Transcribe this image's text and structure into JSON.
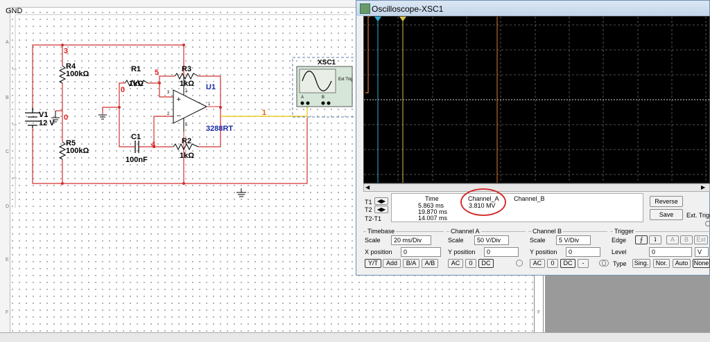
{
  "schematic": {
    "gnd_label": "GND",
    "row_letters": [
      "A",
      "B",
      "C",
      "D",
      "E",
      "F"
    ],
    "components": {
      "v1": {
        "name": "V1",
        "value": "12 V"
      },
      "r4": {
        "name": "R4",
        "value": "100kΩ"
      },
      "r5": {
        "name": "R5",
        "value": "100kΩ"
      },
      "r1": {
        "name": "R1",
        "value": "1kΩ"
      },
      "r3": {
        "name": "R3",
        "value": "1kΩ"
      },
      "r2": {
        "name": "R2",
        "value": "1kΩ"
      },
      "c1": {
        "name": "C1",
        "value": "100nF"
      },
      "u1": {
        "name": "U1",
        "part": "3288RT"
      },
      "xsc1": {
        "name": "XSC1",
        "ext_trig": "Ext Trig",
        "pin_a": "A",
        "pin_b": "B"
      }
    },
    "nodes": {
      "n3": "3",
      "n5": "5",
      "n0a": "0",
      "n0b": "0",
      "n4": "4",
      "n1": "1"
    },
    "opamp_pins": {
      "p1": "1",
      "p2": "2",
      "p3": "3",
      "p4": "4",
      "p5": "5"
    }
  },
  "oscilloscope": {
    "title": "Oscilloscope-XSC1",
    "readout": {
      "t1_label": "T1",
      "t2_label": "T2",
      "t2t1_label": "T2-T1",
      "time_header": "Time",
      "channel_a_header": "Channel_A",
      "channel_b_header": "Channel_B",
      "t1_time": "5.863 ms",
      "t2_time": "19.870 ms",
      "t2t1_time": "14.007 ms",
      "channel_a_value": "3.810 MV"
    },
    "buttons": {
      "reverse": "Reverse",
      "save": "Save",
      "ext_trigger": "Ext. Trigger"
    },
    "timebase": {
      "header": "Timebase",
      "scale_label": "Scale",
      "scale_value": "20 ms/Div",
      "xpos_label": "X position",
      "xpos_value": "0",
      "modes": [
        "Y/T",
        "Add",
        "B/A",
        "A/B"
      ]
    },
    "channel_a": {
      "header": "Channel A",
      "scale_label": "Scale",
      "scale_value": "50  V/Div",
      "ypos_label": "Y position",
      "ypos_value": "0",
      "coupling": [
        "AC",
        "0",
        "DC"
      ]
    },
    "channel_b": {
      "header": "Channel B",
      "scale_label": "Scale",
      "scale_value": "5  V/Div",
      "ypos_label": "Y position",
      "ypos_value": "0",
      "coupling": [
        "AC",
        "0",
        "DC",
        "-"
      ]
    },
    "trigger": {
      "header": "Trigger",
      "edge_label": "Edge",
      "level_label": "Level",
      "level_value": "0",
      "level_unit": "V",
      "type_label": "Type",
      "sources": [
        "A",
        "B",
        "Ext"
      ],
      "types": [
        "Sing.",
        "Nor.",
        "Auto",
        "None"
      ]
    }
  },
  "colors": {
    "wire_red": "#d03030",
    "wire_yellow": "#e8c000",
    "trace_orange": "#e87a2a",
    "cursor_cyan": "#2fb0d0",
    "annotation_red": "#d42020"
  }
}
